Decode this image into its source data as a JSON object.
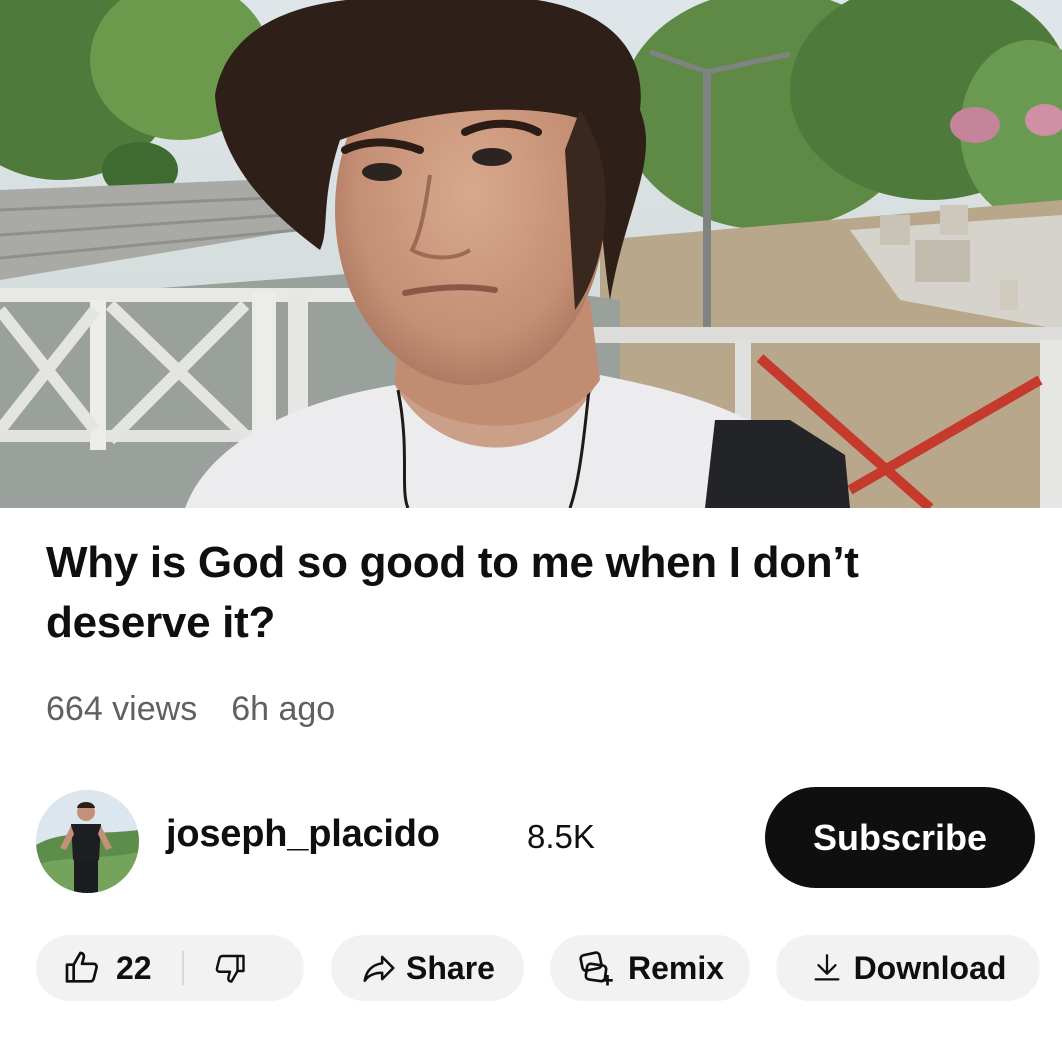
{
  "video": {
    "title": "Why is God so good to me when I don’t deserve it?",
    "views": "664 views",
    "age": "6h ago"
  },
  "channel": {
    "name": "joseph_placido",
    "subscribers": "8.5K",
    "avatar_icon": "channel-avatar"
  },
  "actions": {
    "subscribe_label": "Subscribe",
    "like_count": "22",
    "share_label": "Share",
    "remix_label": "Remix",
    "download_label": "Download"
  },
  "icons": {
    "like": "thumbs-up-icon",
    "dislike": "thumbs-down-icon",
    "share": "share-arrow-icon",
    "remix": "remix-icon",
    "download": "download-icon"
  },
  "colors": {
    "subscribe_bg": "#0f0f0f",
    "pill_bg": "#f2f2f2",
    "meta_text": "#606060"
  }
}
